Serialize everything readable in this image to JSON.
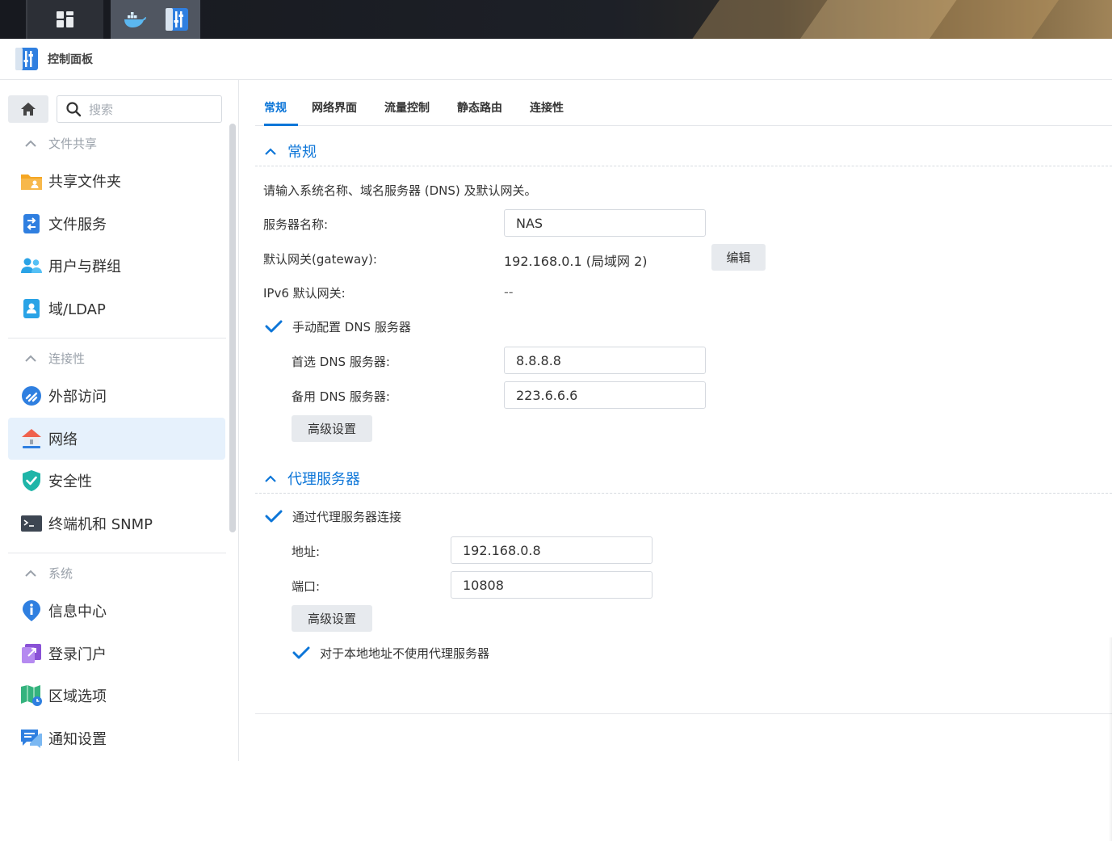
{
  "window": {
    "title": "控制面板"
  },
  "sidebar": {
    "search_placeholder": "搜索",
    "sections": [
      {
        "label": "文件共享",
        "items": [
          {
            "label": "共享文件夹",
            "icon": "folder-share-icon"
          },
          {
            "label": "文件服务",
            "icon": "file-services-icon"
          },
          {
            "label": "用户与群组",
            "icon": "users-icon"
          },
          {
            "label": "域/LDAP",
            "icon": "domain-ldap-icon"
          }
        ]
      },
      {
        "label": "连接性",
        "items": [
          {
            "label": "外部访问",
            "icon": "external-access-icon"
          },
          {
            "label": "网络",
            "icon": "network-icon",
            "active": true
          },
          {
            "label": "安全性",
            "icon": "security-shield-icon"
          },
          {
            "label": "终端机和 SNMP",
            "icon": "terminal-icon"
          }
        ]
      },
      {
        "label": "系统",
        "items": [
          {
            "label": "信息中心",
            "icon": "info-icon"
          },
          {
            "label": "登录门户",
            "icon": "login-portal-icon"
          },
          {
            "label": "区域选项",
            "icon": "region-icon"
          },
          {
            "label": "通知设置",
            "icon": "notification-icon"
          }
        ]
      }
    ]
  },
  "tabs": [
    "常规",
    "网络界面",
    "流量控制",
    "静态路由",
    "连接性"
  ],
  "general": {
    "title": "常规",
    "description": "请输入系统名称、域名服务器 (DNS) 及默认网关。",
    "server_name_label": "服务器名称:",
    "server_name_value": "NAS",
    "gateway_label": "默认网关(gateway):",
    "gateway_value": "192.168.0.1 (局域网 2)",
    "edit_button": "编辑",
    "ipv6_label": "IPv6 默认网关:",
    "ipv6_value": "--",
    "manual_dns_label": "手动配置 DNS 服务器",
    "preferred_dns_label": "首选 DNS 服务器:",
    "preferred_dns_value": "8.8.8.8",
    "alternate_dns_label": "备用 DNS 服务器:",
    "alternate_dns_value": "223.6.6.6",
    "advanced_button": "高级设置"
  },
  "proxy": {
    "title": "代理服务器",
    "connect_via_proxy_label": "通过代理服务器连接",
    "address_label": "地址:",
    "address_value": "192.168.0.8",
    "port_label": "端口:",
    "port_value": "10808",
    "advanced_button": "高级设置",
    "bypass_local_label": "对于本地地址不使用代理服务器"
  },
  "colors": {
    "accent": "#0d76d8",
    "active_bg": "#e6f1fc",
    "button_bg": "#e7eaee"
  }
}
